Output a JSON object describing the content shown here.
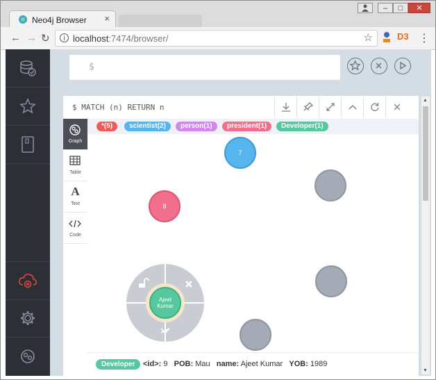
{
  "browser": {
    "tab_title": "Neo4j Browser",
    "tab_close": "×",
    "url_host": "localhost",
    "url_rest": ":7474/browser/",
    "win_min": "–",
    "win_max": "□",
    "win_close": "✕"
  },
  "editor": {
    "prompt": "$"
  },
  "frame": {
    "query": "$ MATCH (n) RETURN n"
  },
  "view_tabs": [
    {
      "label": "Graph"
    },
    {
      "label": "Table"
    },
    {
      "label": "Text"
    },
    {
      "label": "Code"
    }
  ],
  "legend": [
    {
      "label": "*(5)",
      "color": "#f25a5a"
    },
    {
      "label": "scientist(2)",
      "color": "#57b5ee"
    },
    {
      "label": "person(1)",
      "color": "#d089e8"
    },
    {
      "label": "president(1)",
      "color": "#f16f8a"
    },
    {
      "label": "Developer(1)",
      "color": "#57c7a0"
    }
  ],
  "nodes": {
    "blue_label": "7",
    "pink_label": "8",
    "selected_label": "Ajeet Kumar"
  },
  "status": {
    "label": "Developer",
    "id_key": "<id>:",
    "id_val": "9",
    "pob_key": "POB:",
    "pob_val": "Mau",
    "name_key": "name:",
    "name_val": "Ajeet Kumar",
    "yob_key": "YOB:",
    "yob_val": "1989"
  },
  "colors": {
    "sidebar": "#2d2f36",
    "main_bg": "#d4dce4",
    "node_gray": "#a5abb6",
    "node_blue": "#57b5ee",
    "node_pink": "#f16f8a",
    "node_green": "#57c7a0",
    "cloud_alert": "#e0443a"
  }
}
